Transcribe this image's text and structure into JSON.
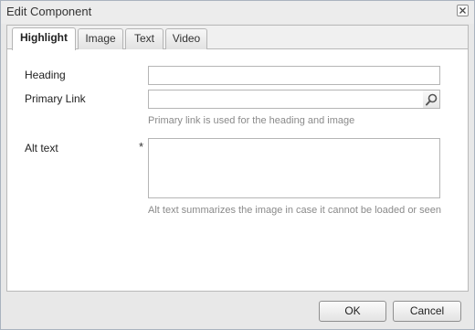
{
  "dialog": {
    "title": "Edit Component"
  },
  "tabs": [
    {
      "label": "Highlight"
    },
    {
      "label": "Image"
    },
    {
      "label": "Text"
    },
    {
      "label": "Video"
    }
  ],
  "form": {
    "heading": {
      "label": "Heading",
      "value": ""
    },
    "primary_link": {
      "label": "Primary Link",
      "value": "",
      "hint": "Primary link is used for the heading and image"
    },
    "alt_text": {
      "label": "Alt text",
      "required_marker": "*",
      "value": "",
      "hint": "Alt text summarizes the image in case it cannot be loaded or seen"
    }
  },
  "footer": {
    "ok_label": "OK",
    "cancel_label": "Cancel"
  },
  "icons": {
    "close": "close-icon",
    "search": "search-icon"
  }
}
